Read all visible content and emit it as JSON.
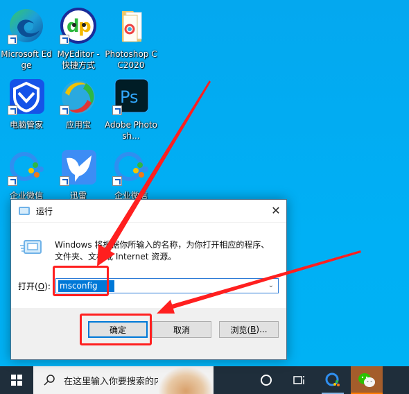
{
  "desktop": {
    "icons": [
      {
        "label": "Microsoft Edge",
        "icon": "edge-icon"
      },
      {
        "label": "MyEditor - 快捷方式",
        "icon": "myeditor-icon"
      },
      {
        "label": "Photoshop CC2020",
        "icon": "folder-icon"
      },
      {
        "label": "电脑管家",
        "icon": "tencent-pc-manager-icon"
      },
      {
        "label": "应用宝",
        "icon": "yingyongbao-icon"
      },
      {
        "label": "Adobe Photosh...",
        "icon": "photoshop-icon"
      },
      {
        "label": "企业微信",
        "icon": "wecom-icon"
      },
      {
        "label": "迅雷",
        "icon": "xunlei-icon"
      },
      {
        "label": "企业微信",
        "icon": "wecom-icon"
      }
    ]
  },
  "dialog": {
    "title": "运行",
    "description": "Windows 将根据你所输入的名称，为你打开相应的程序、文件夹、文档或 Internet 资源。",
    "open_label": "打开(",
    "open_accesskey": "O",
    "open_label_suffix": "):",
    "input_value": "msconfig",
    "ok_label": "确定",
    "cancel_label": "取消",
    "browse_label": "浏览(",
    "browse_accesskey": "B",
    "browse_suffix": ")..."
  },
  "annotations": {
    "highlight_color": "#ff1f1f"
  },
  "taskbar": {
    "search_placeholder": "在这里输入你要搜索的内容"
  }
}
